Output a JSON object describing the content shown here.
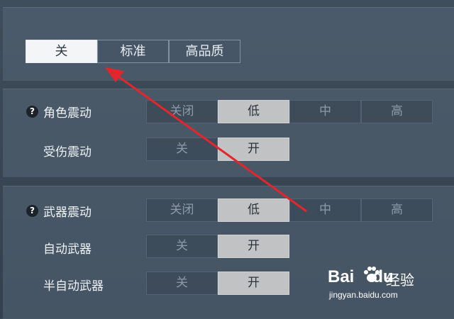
{
  "quality": {
    "options": [
      "关",
      "标准",
      "高品质"
    ],
    "selected": 0
  },
  "section1": {
    "character_vibration": {
      "label": "角色震动",
      "help": "?",
      "options": [
        "关闭",
        "低",
        "中",
        "高"
      ],
      "selected": 1
    },
    "hurt_vibration": {
      "label": "受伤震动",
      "options": [
        "关",
        "开"
      ],
      "selected": 1
    }
  },
  "section2": {
    "weapon_vibration": {
      "label": "武器震动",
      "help": "?",
      "options": [
        "关闭",
        "低",
        "中",
        "高"
      ],
      "selected": 1
    },
    "auto_weapon": {
      "label": "自动武器",
      "options": [
        "关",
        "开"
      ],
      "selected": 1
    },
    "semi_auto_weapon": {
      "label": "半自动武器",
      "options": [
        "关",
        "开"
      ],
      "selected": 1
    }
  },
  "annotation": {
    "arrow_color": "#e3262b"
  },
  "watermark": {
    "brand": "Bai",
    "brand_suffix": "du",
    "cn": "经验",
    "url": "jingyan.baidu.com"
  }
}
